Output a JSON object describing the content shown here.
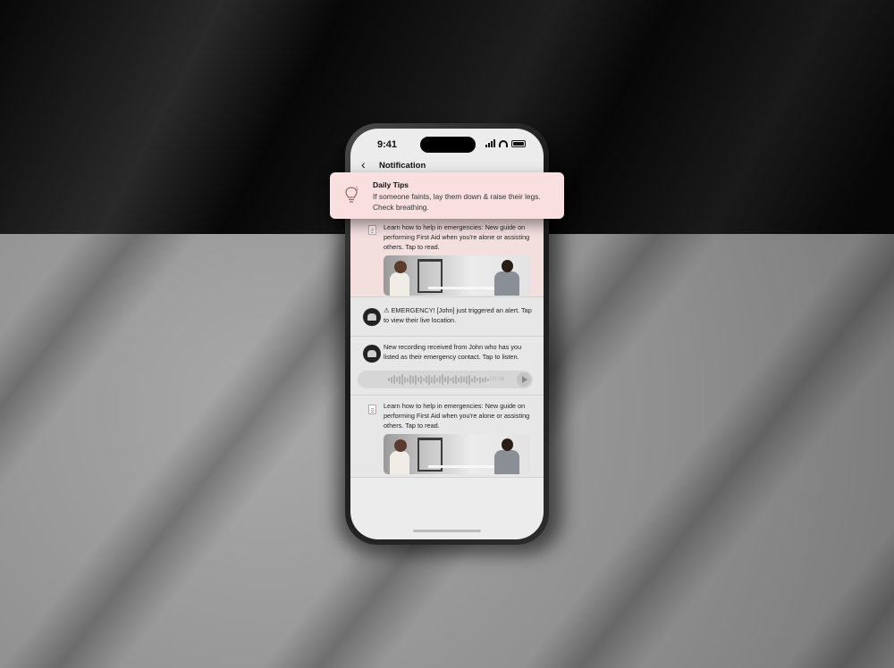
{
  "status": {
    "time": "9:41"
  },
  "nav": {
    "title": "Notification"
  },
  "banner": {
    "title": "Daily Tips",
    "text": "If someone faints, lay them down & raise their legs. Check breathing."
  },
  "notifications": [
    {
      "kind": "guide",
      "text": "Learn how to help in emergencies: New guide on performing First Aid when you're alone or assisting others. Tap to read."
    },
    {
      "kind": "alert",
      "text": "⚠ EMERGENCY! [John] just triggered an alert. Tap to view their live location."
    },
    {
      "kind": "recording",
      "text": "New recording received from John who has you listed as their emergency contact. Tap to listen.",
      "duration": "00:06"
    },
    {
      "kind": "guide",
      "text": "Learn how to help in emergencies: New guide on performing First Aid when you're alone or assisting others. Tap to read."
    }
  ]
}
